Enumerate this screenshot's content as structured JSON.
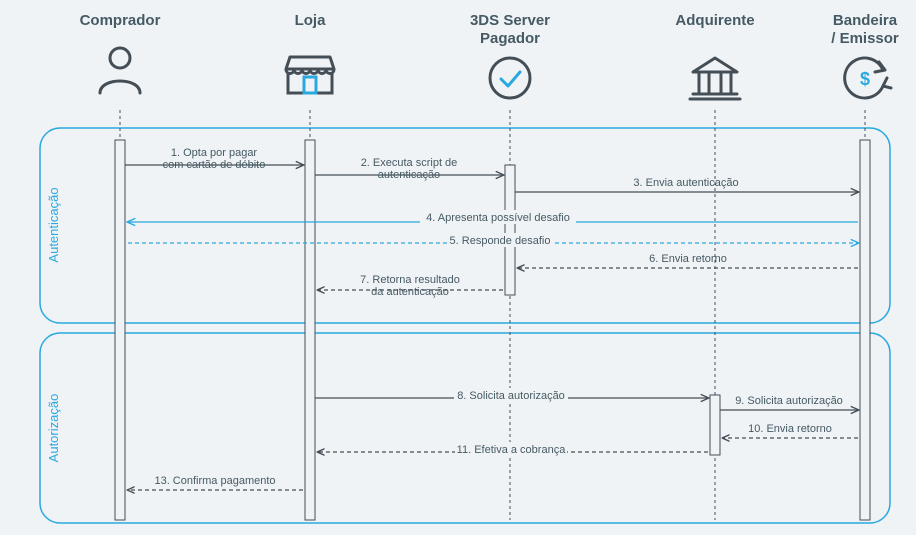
{
  "actors": {
    "comprador": "Comprador",
    "loja": "Loja",
    "tds1": "3DS Server",
    "tds2": "Pagador",
    "adquirente": "Adquirente",
    "bandeira1": "Bandeira",
    "bandeira2": "/ Emissor"
  },
  "phases": {
    "auth": "Autenticação",
    "authz": "Autorização"
  },
  "messages": {
    "m1a": "1. Opta por pagar",
    "m1b": "com cartão de débito",
    "m2a": "2. Executa script de",
    "m2b": "autenticação",
    "m3": "3. Envia autenticação",
    "m4": "4. Apresenta possível desafio",
    "m5": "5. Responde desafio",
    "m6": "6. Envia retorno",
    "m7a": "7. Retorna resultado",
    "m7b": "da autenticação",
    "m8": "8. Solicita autorização",
    "m9": "9. Solicita autorização",
    "m10": "10. Envia retorno",
    "m11": "11. Efetiva a cobrança",
    "m13": "13. Confirma pagamento"
  }
}
